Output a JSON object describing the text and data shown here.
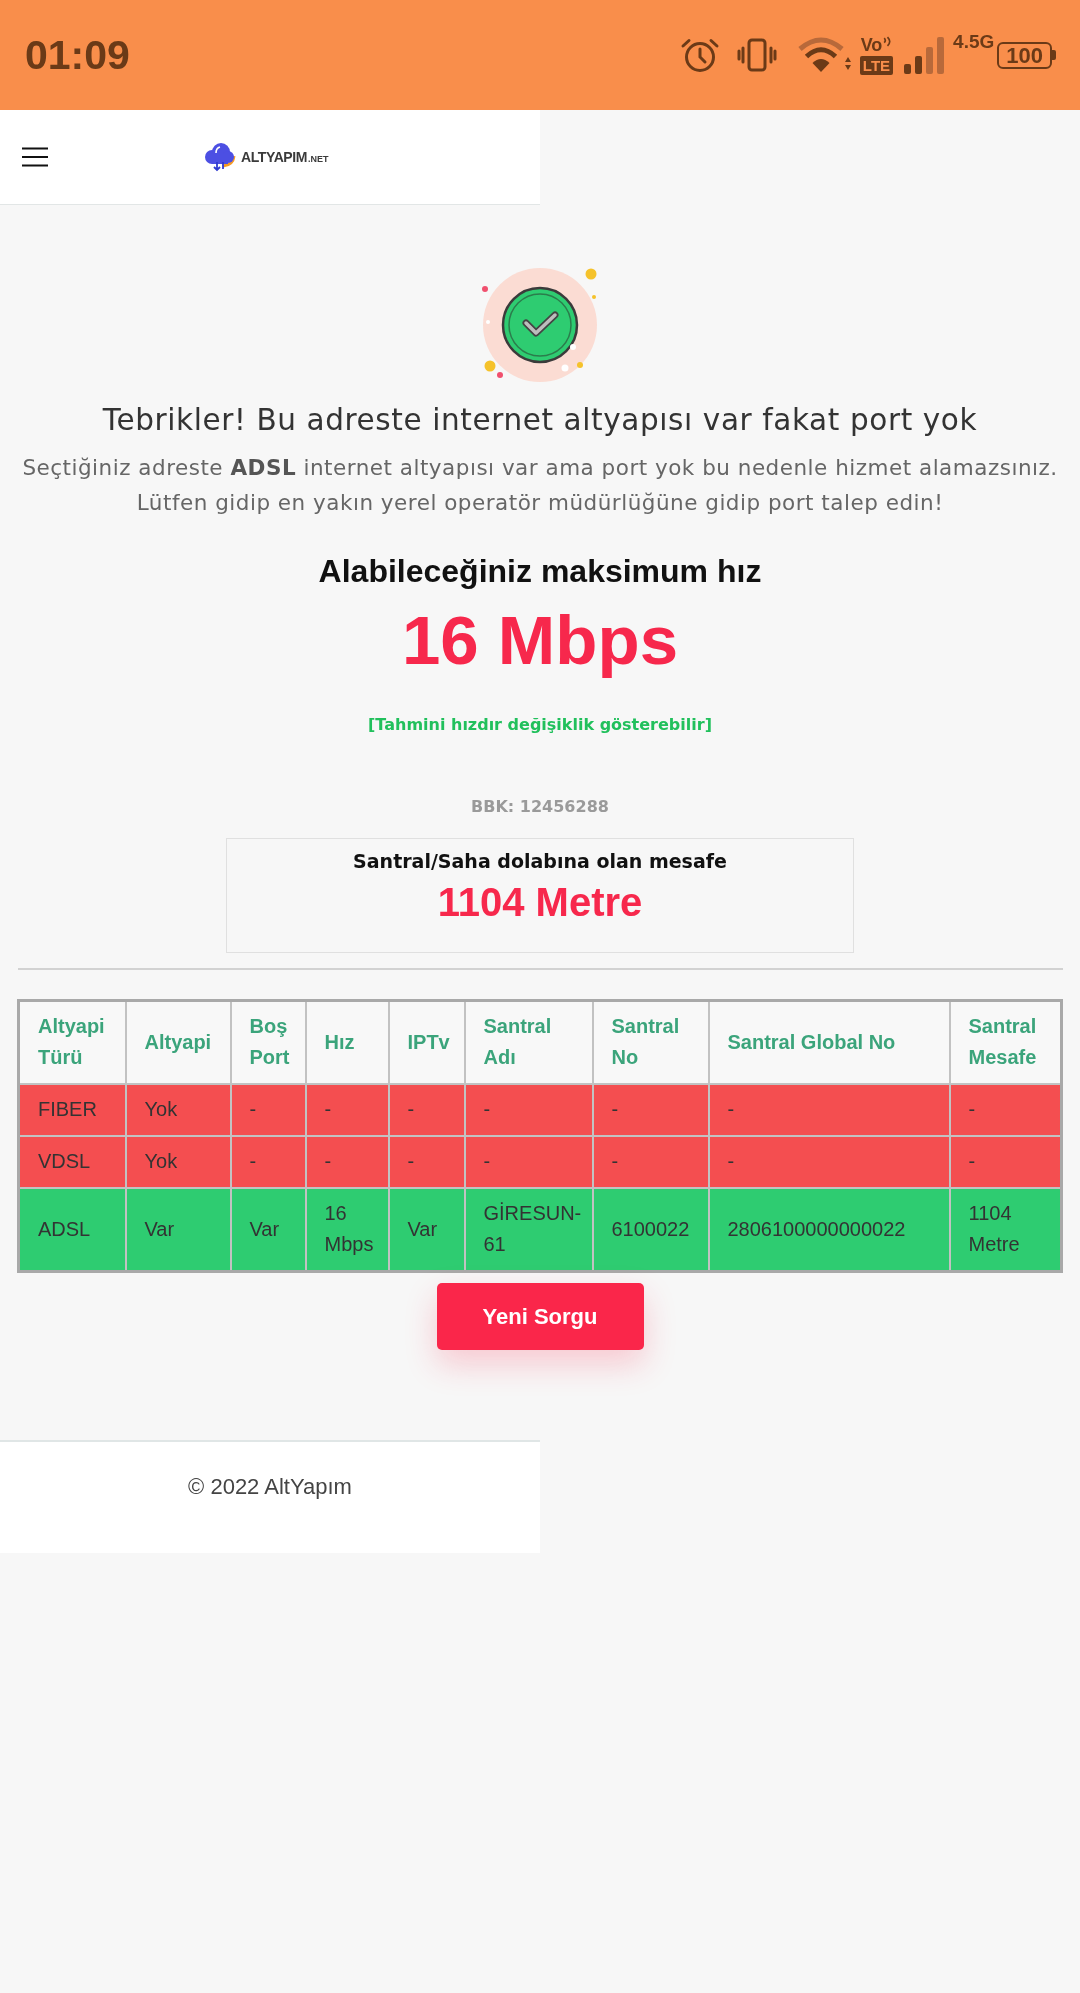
{
  "status_bar": {
    "time": "01:09",
    "volte": [
      "Vo",
      "LTE"
    ],
    "network": "4.5G",
    "battery": "100"
  },
  "header": {
    "logo": {
      "name": "ALTYAPIM",
      "domain": ".NET"
    }
  },
  "result": {
    "title": "Tebrikler! Bu adreste internet altyapısı var fakat port yok",
    "message": "Seçtiğiniz adreste **ADSL** internet altyapısı var ama port yok bu nedenle hizmet alamazsınız. Lütfen gidip en yakın yerel operatör müdürlüğüne gidip port talep edin!"
  },
  "speed": {
    "label": "Alabileceğiniz maksimum hız",
    "value": "16 Mbps",
    "note": "[Tahmini hızdır değişiklik gösterebilir]"
  },
  "bbk": "BBK: 12456288",
  "distance": {
    "label": "Santral/Saha dolabına olan mesafe",
    "value": "1104 Metre"
  },
  "table": {
    "columns": [
      "Altyapi Türü",
      "Altyapi",
      "Boş Port",
      "Hız",
      "IPTv",
      "Santral Adı",
      "Santral No",
      "Santral Global No",
      "Santral Mesafe"
    ],
    "rows": [
      {
        "available": false,
        "cells": [
          "FIBER",
          "Yok",
          "-",
          "-",
          "-",
          "-",
          "-",
          "-",
          "-"
        ]
      },
      {
        "available": false,
        "cells": [
          "VDSL",
          "Yok",
          "-",
          "-",
          "-",
          "-",
          "-",
          "-",
          "-"
        ]
      },
      {
        "available": true,
        "cells": [
          "ADSL",
          "Var",
          "Var",
          "16 Mbps",
          "Var",
          "GİRESUN-61",
          "6100022",
          "2806100000000022",
          "1104 Metre"
        ]
      }
    ]
  },
  "button": "Yeni Sorgu",
  "footer": "© 2022 AltYapım"
}
